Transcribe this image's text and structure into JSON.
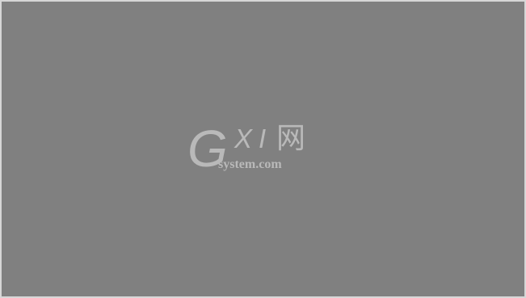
{
  "watermark": {
    "letter_g": "G",
    "letters_xi": "XI",
    "char_wang": "网",
    "domain": "system.com"
  },
  "colors": {
    "background": "#808080",
    "border": "#d7d7d7",
    "watermark_text": "#b9b9b9"
  }
}
